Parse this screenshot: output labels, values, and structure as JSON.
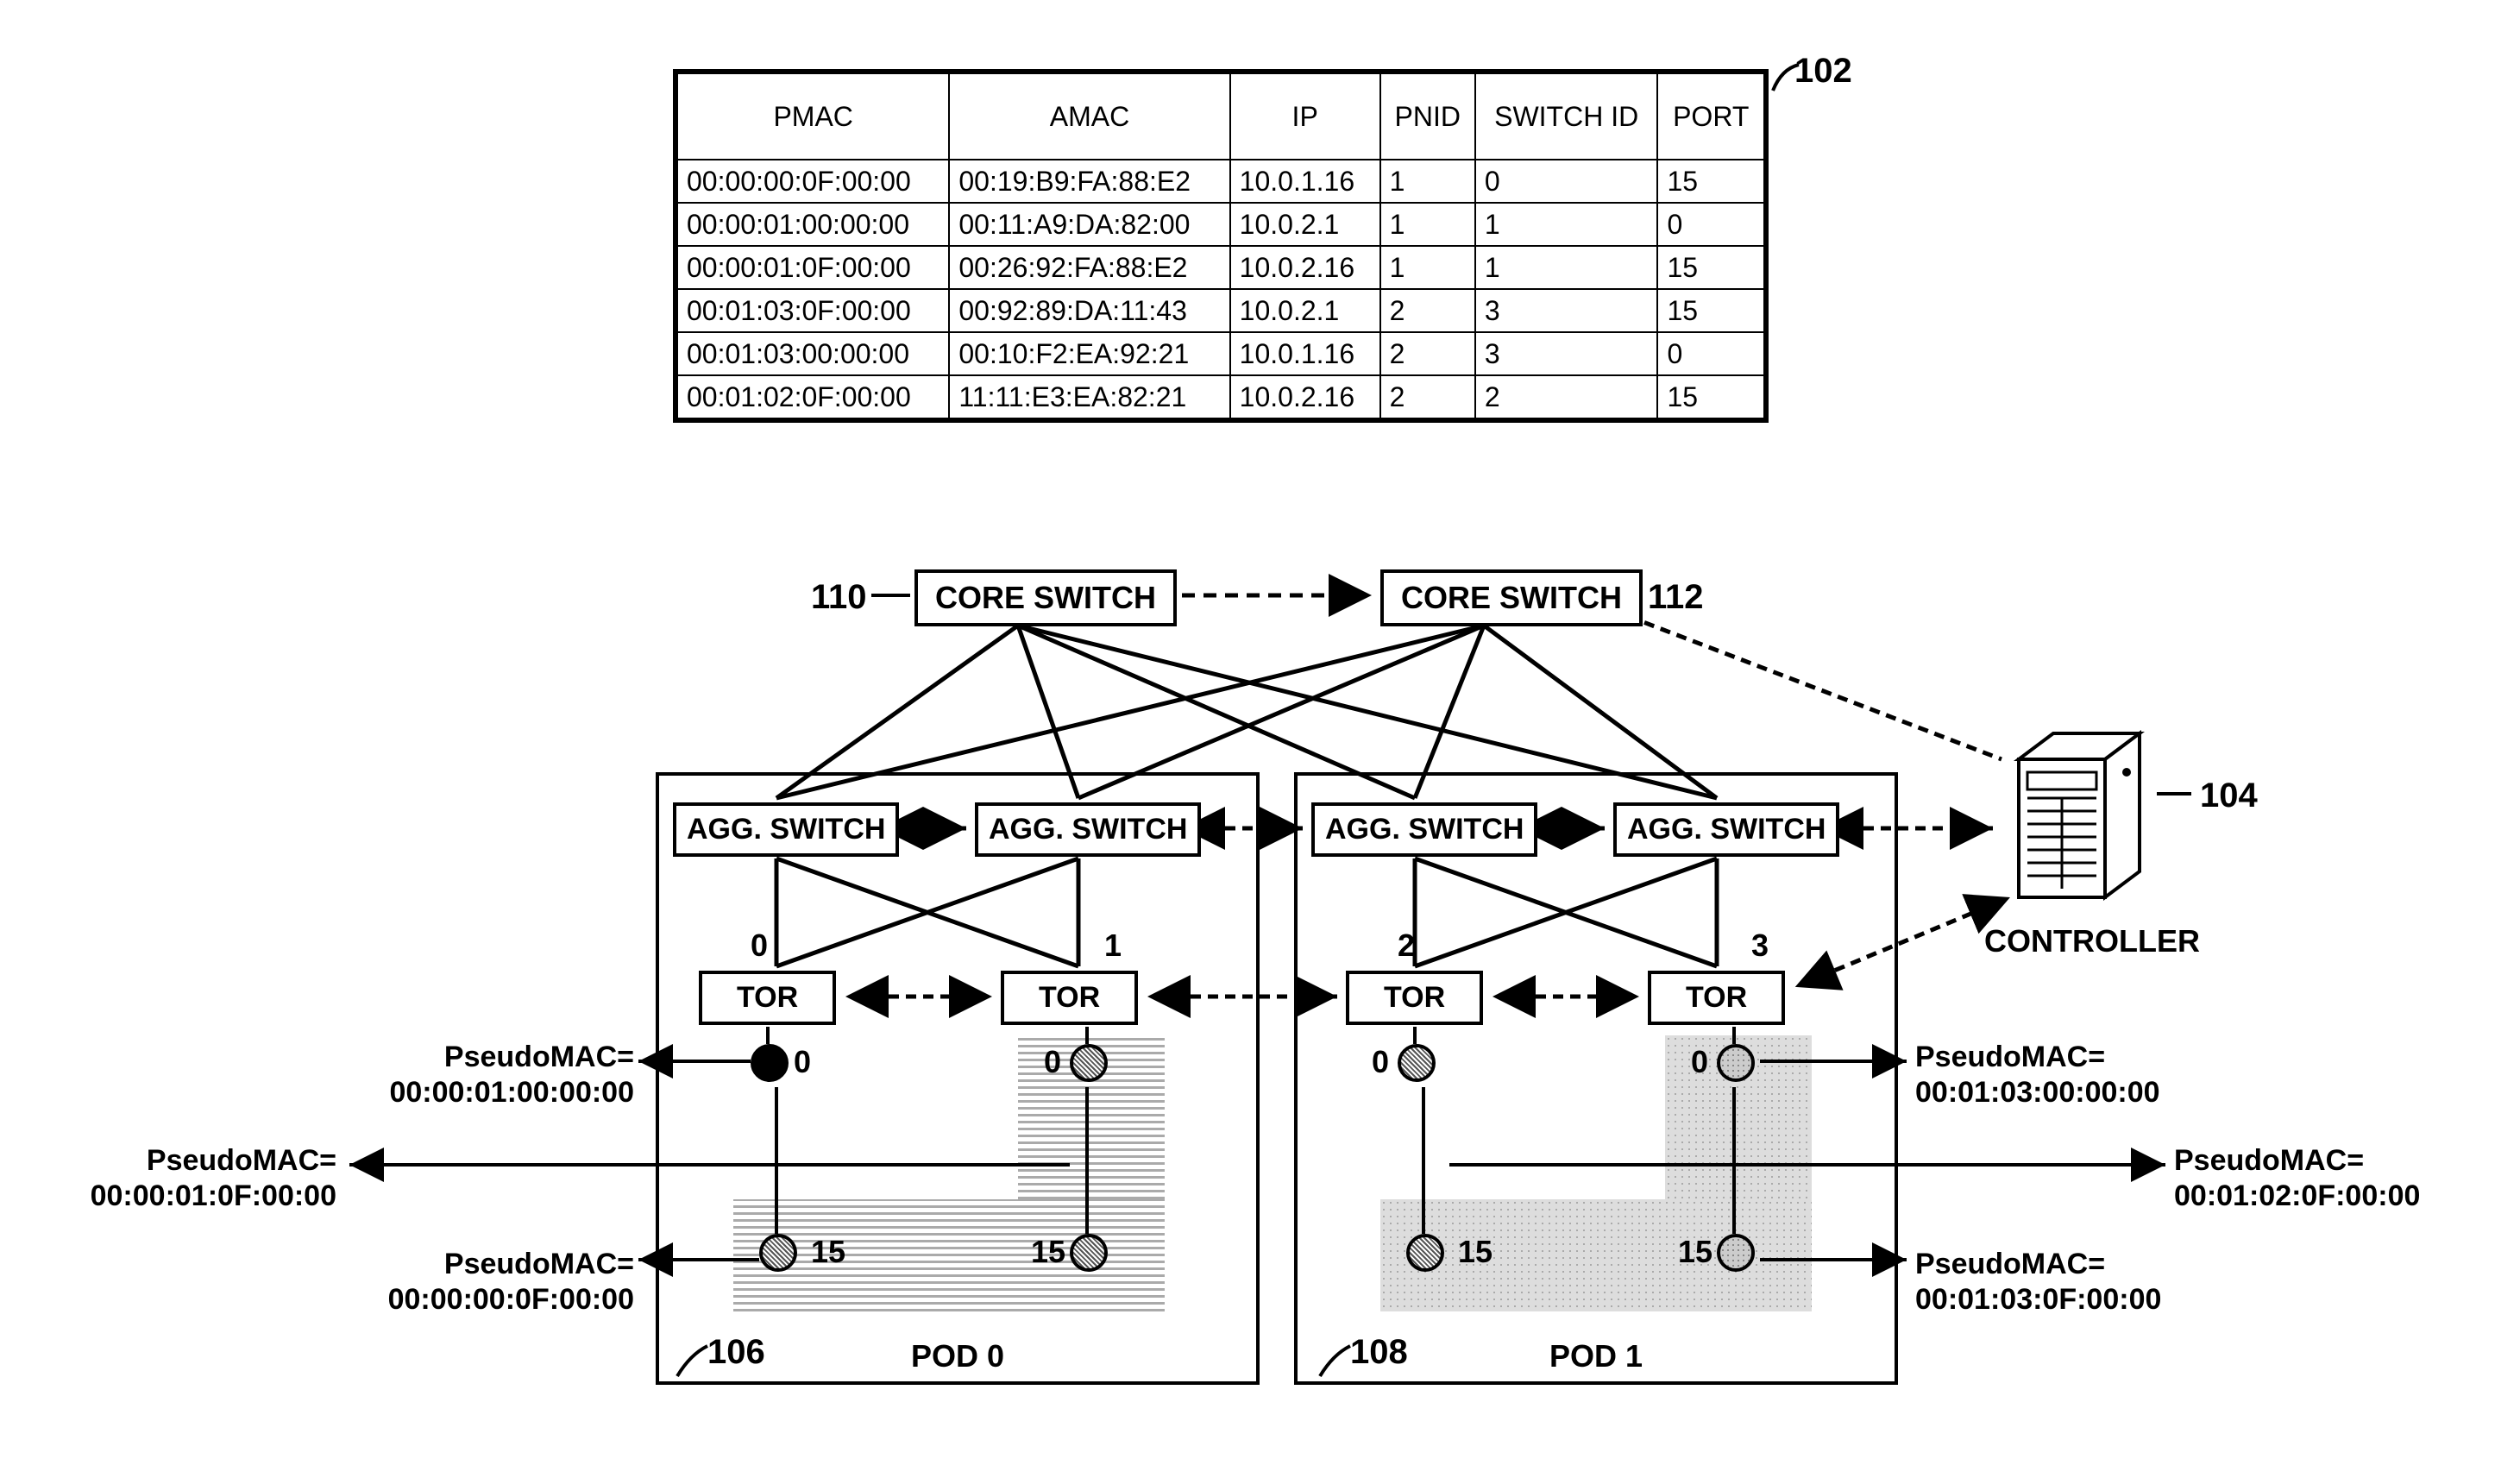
{
  "refs": {
    "r102": "102",
    "r104": "104",
    "r106": "106",
    "r108": "108",
    "r110": "110",
    "r112": "112"
  },
  "table": {
    "headers": [
      "PMAC",
      "AMAC",
      "IP",
      "PNID",
      "SWITCH ID",
      "PORT"
    ],
    "rows": [
      [
        "00:00:00:0F:00:00",
        "00:19:B9:FA:88:E2",
        "10.0.1.16",
        "1",
        "0",
        "15"
      ],
      [
        "00:00:01:00:00:00",
        "00:11:A9:DA:82:00",
        "10.0.2.1",
        "1",
        "1",
        "0"
      ],
      [
        "00:00:01:0F:00:00",
        "00:26:92:FA:88:E2",
        "10.0.2.16",
        "1",
        "1",
        "15"
      ],
      [
        "00:01:03:0F:00:00",
        "00:92:89:DA:11:43",
        "10.0.2.1",
        "2",
        "3",
        "15"
      ],
      [
        "00:01:03:00:00:00",
        "00:10:F2:EA:92:21",
        "10.0.1.16",
        "2",
        "3",
        "0"
      ],
      [
        "00:01:02:0F:00:00",
        "11:11:E3:EA:82:21",
        "10.0.2.16",
        "2",
        "2",
        "15"
      ]
    ]
  },
  "switches": {
    "core": "CORE SWITCH",
    "agg": "AGG. SWITCH",
    "tor": "TOR"
  },
  "pods": {
    "pod0": "POD 0",
    "pod1": "POD 1"
  },
  "controller": "CONTROLLER",
  "torNums": [
    "0",
    "1",
    "2",
    "3"
  ],
  "portLabels": {
    "p0": "0",
    "p15": "15"
  },
  "pmacLabels": {
    "l1": {
      "pre": "PseudoMAC=",
      "mac": "00:00:01:00:00:00"
    },
    "l2": {
      "pre": "PseudoMAC=",
      "mac": "00:00:01:0F:00:00"
    },
    "l3": {
      "pre": "PseudoMAC=",
      "mac": "00:00:00:0F:00:00"
    },
    "r1": {
      "pre": "PseudoMAC=",
      "mac": "00:01:03:00:00:00"
    },
    "r2": {
      "pre": "PseudoMAC=",
      "mac": "00:01:02:0F:00:00"
    },
    "r3": {
      "pre": "PseudoMAC=",
      "mac": "00:01:03:0F:00:00"
    }
  }
}
